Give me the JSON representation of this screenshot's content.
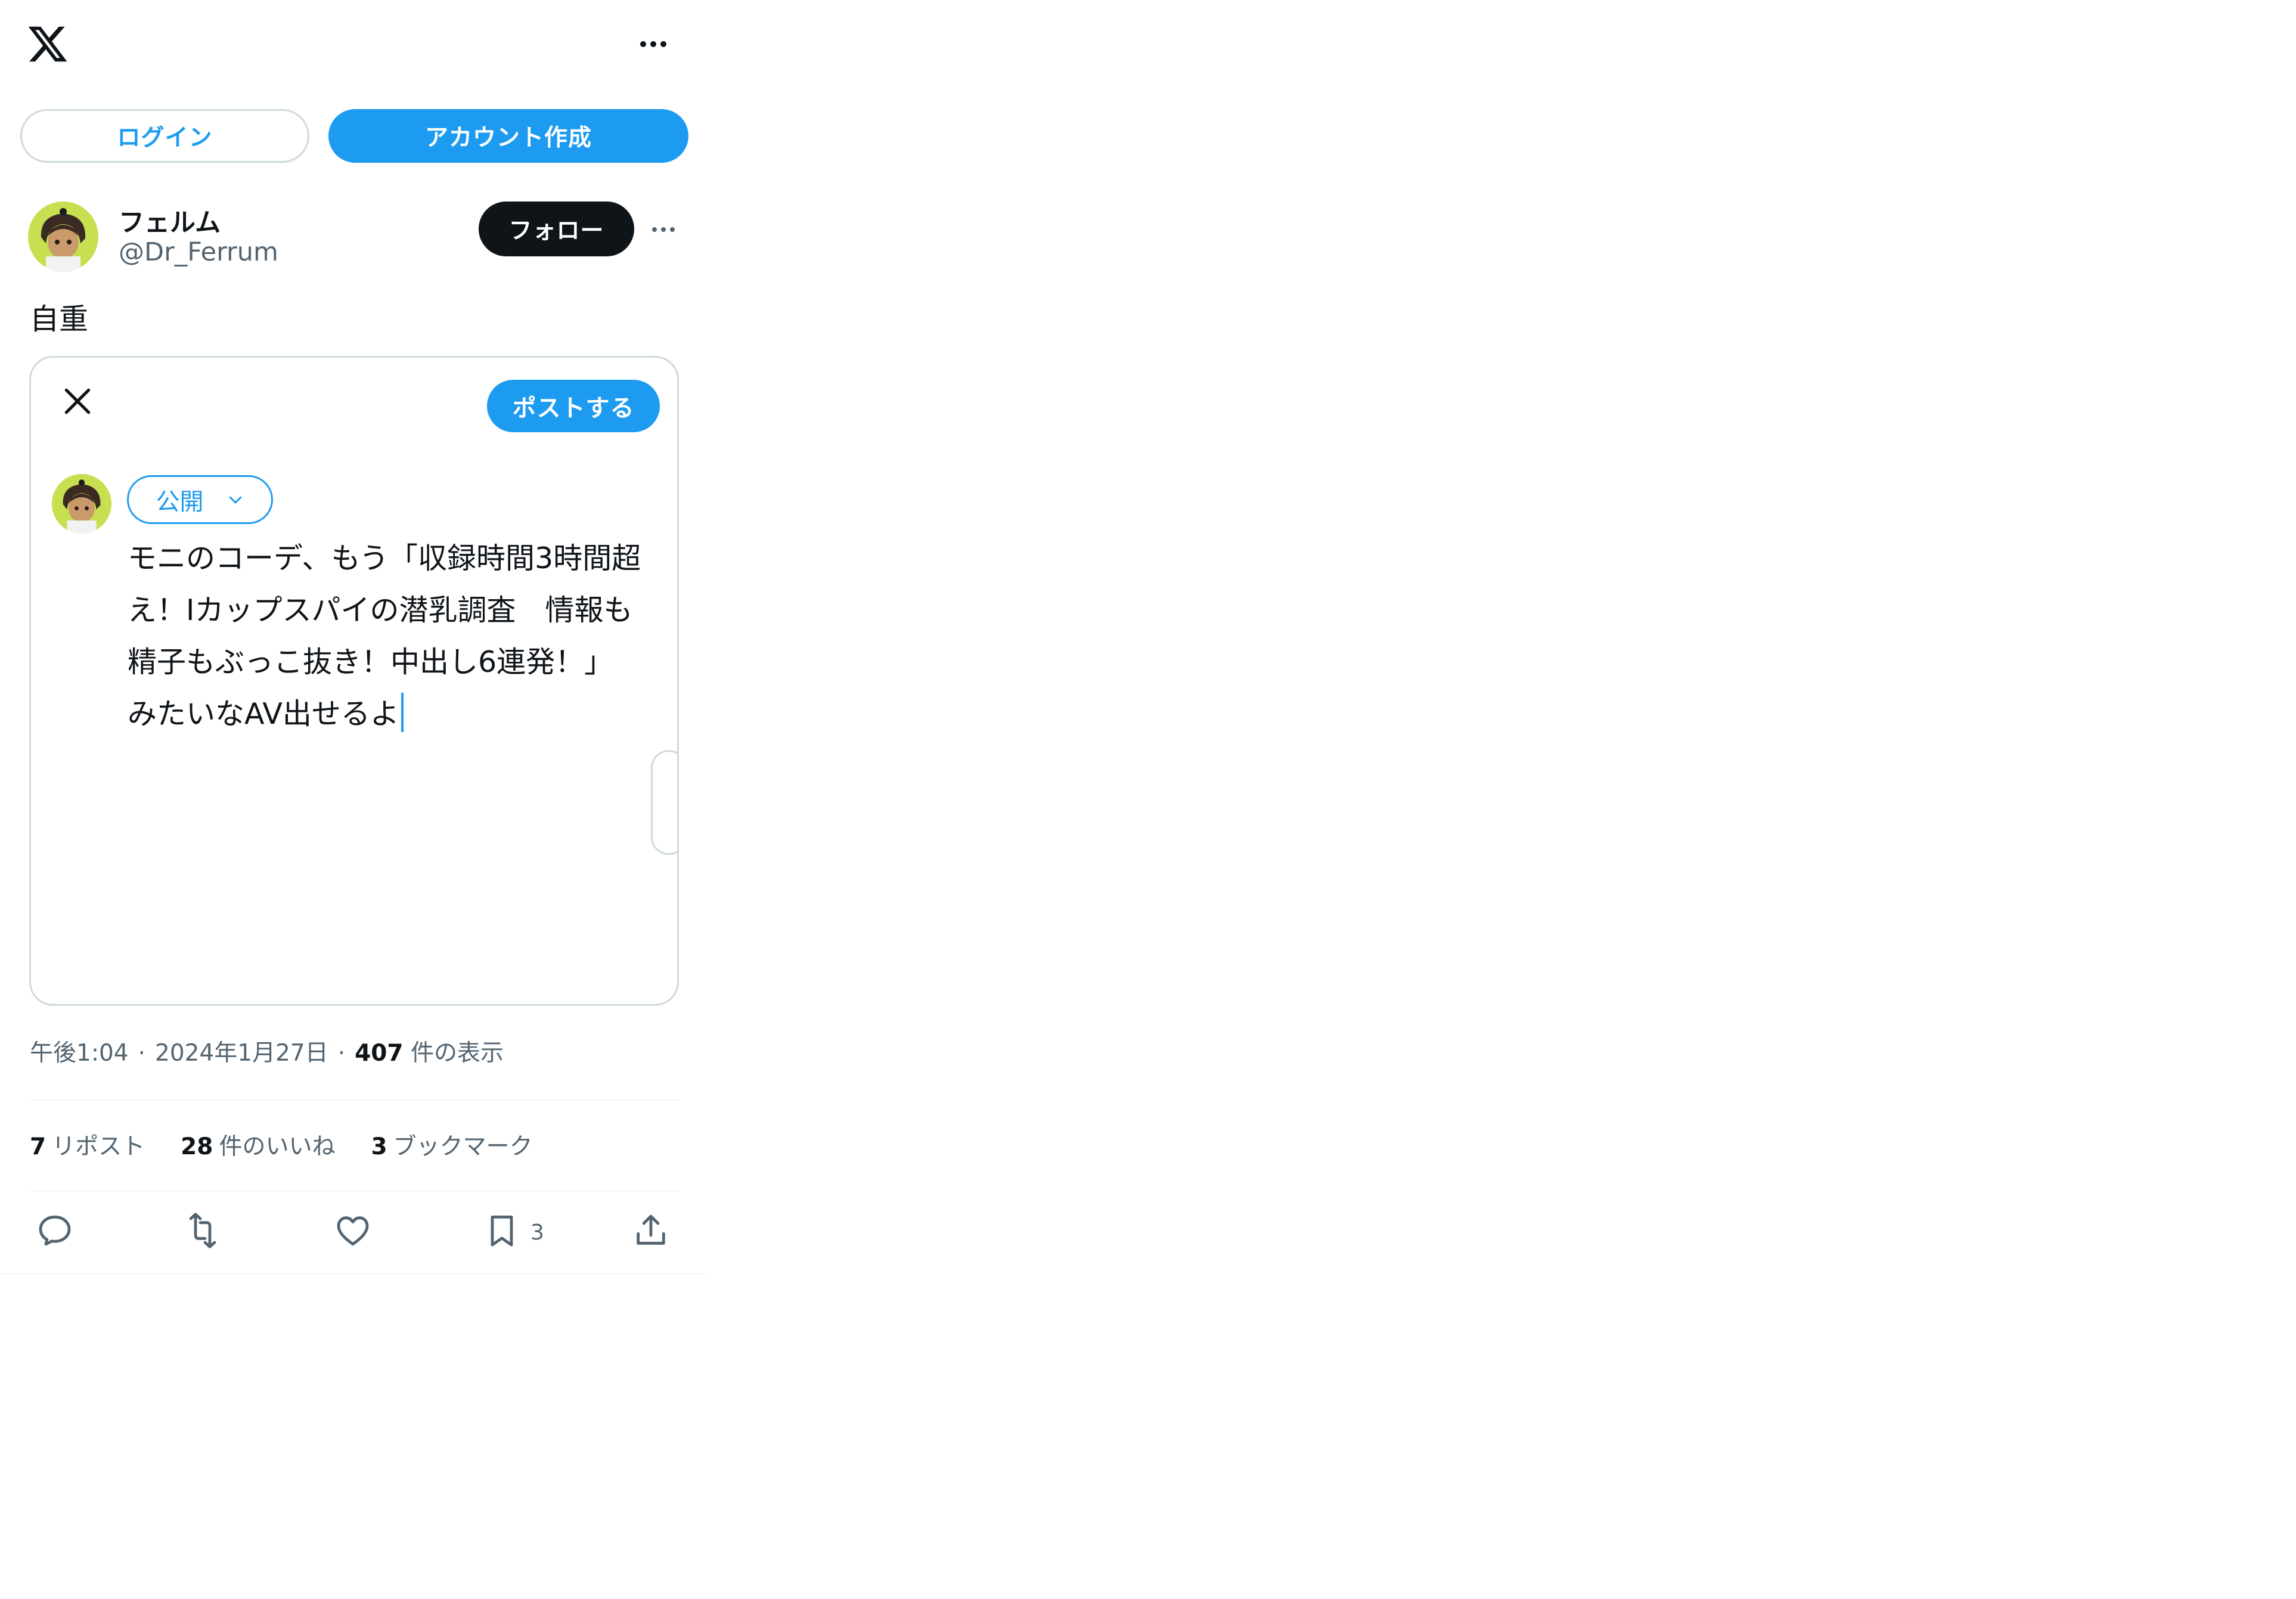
{
  "header": {
    "logo_icon": "x-logo-icon",
    "more_icon": "more-horizontal-icon"
  },
  "auth": {
    "login_label": "ログイン",
    "signup_label": "アカウント作成"
  },
  "author": {
    "name": "フェルム",
    "handle": "@Dr_Ferrum",
    "follow_label": "フォロー"
  },
  "tweet": {
    "text": "自重"
  },
  "embed": {
    "post_label": "ポストする",
    "audience_label": "公開",
    "compose_lines": [
      "モニのコーデ、もう「収録時間3時間超",
      "え！Iカップスパイの潜乳調査　情報も",
      "精子もぶっこ抜き！中出し6連発！」",
      "みたいなAV出せるよ"
    ]
  },
  "meta": {
    "time": "午後1:04",
    "date": "2024年1月27日",
    "views_count": "407",
    "views_label": "件の表示"
  },
  "stats": {
    "reposts_count": "7",
    "reposts_label": "リポスト",
    "likes_count": "28",
    "likes_label": "件のいいね",
    "bookmarks_count": "3",
    "bookmarks_label": "ブックマーク"
  },
  "actions": {
    "bookmark_count": "3"
  },
  "colors": {
    "accent": "#1d9bf0",
    "text": "#0f1419",
    "secondary": "#536471",
    "border": "#cfd9de"
  }
}
